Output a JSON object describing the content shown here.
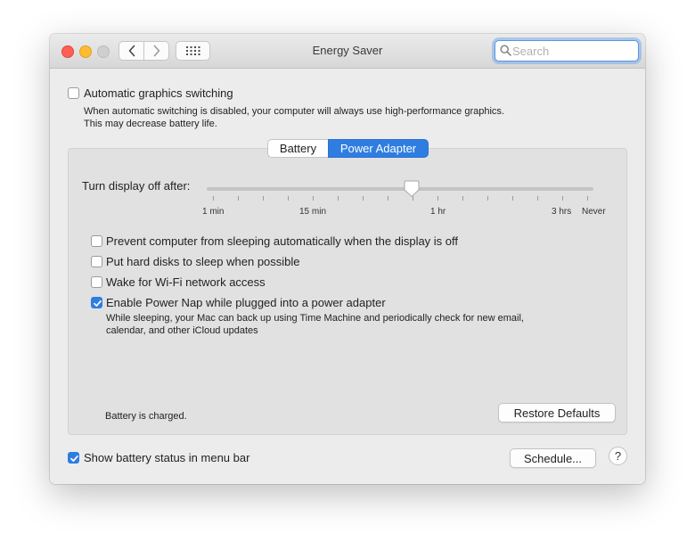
{
  "window": {
    "title": "Energy Saver"
  },
  "search": {
    "placeholder": "Search",
    "value": ""
  },
  "auto_graphics": {
    "label": "Automatic graphics switching",
    "checked": false,
    "description_line1": "When automatic switching is disabled, your computer will always use high-performance graphics.",
    "description_line2": "This may decrease battery life."
  },
  "tabs": [
    {
      "label": "Battery",
      "selected": false
    },
    {
      "label": "Power Adapter",
      "selected": true
    }
  ],
  "display_off": {
    "label": "Turn display off after:",
    "ticks": [
      "1 min",
      "15 min",
      "1 hr",
      "3 hrs",
      "Never"
    ],
    "value": "1 hr"
  },
  "options": [
    {
      "label": "Prevent computer from sleeping automatically when the display is off",
      "checked": false
    },
    {
      "label": "Put hard disks to sleep when possible",
      "checked": false
    },
    {
      "label": "Wake for Wi-Fi network access",
      "checked": false
    },
    {
      "label": "Enable Power Nap while plugged into a power adapter",
      "checked": true,
      "description_line1": "While sleeping, your Mac can back up using Time Machine and periodically check for new email,",
      "description_line2": "calendar, and other iCloud updates"
    }
  ],
  "battery_status": "Battery is charged.",
  "restore_button": "Restore Defaults",
  "show_battery": {
    "label": "Show battery status in menu bar",
    "checked": true
  },
  "schedule_button": "Schedule...",
  "help_button": "?",
  "colors": {
    "accent": "#2f7de1"
  }
}
